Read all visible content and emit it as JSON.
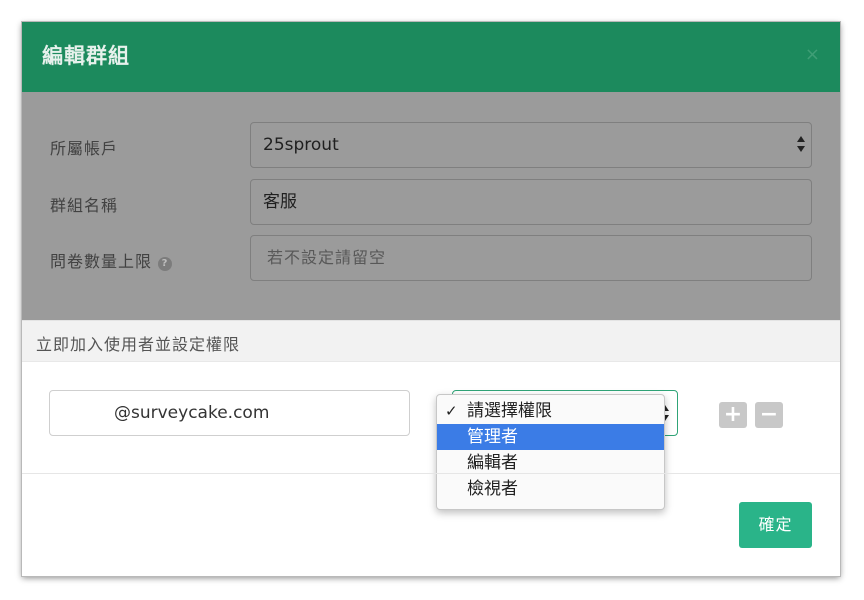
{
  "modal": {
    "title": "編輯群組",
    "close_symbol": "×"
  },
  "form": {
    "account": {
      "label": "所屬帳戶",
      "value": "25sprout"
    },
    "group_name": {
      "label": "群組名稱",
      "value": "客服"
    },
    "survey_limit": {
      "label": "問卷數量上限",
      "help_symbol": "?",
      "placeholder": "若不設定請留空"
    }
  },
  "section": {
    "title": "立即加入使用者並設定權限"
  },
  "user_row": {
    "email_value": "@surveycake.com",
    "add_symbol": "+",
    "remove_symbol": "−"
  },
  "permission_dropdown": {
    "check_symbol": "✓",
    "options": [
      "請選擇權限",
      "管理者",
      "編輯者",
      "檢視者"
    ],
    "selected_index": 0,
    "highlighted_index": 1
  },
  "footer": {
    "confirm_label": "確定"
  },
  "colors": {
    "header": "#1c8a5d",
    "primary_button": "#2ab489",
    "highlight": "#3b7ce6"
  }
}
